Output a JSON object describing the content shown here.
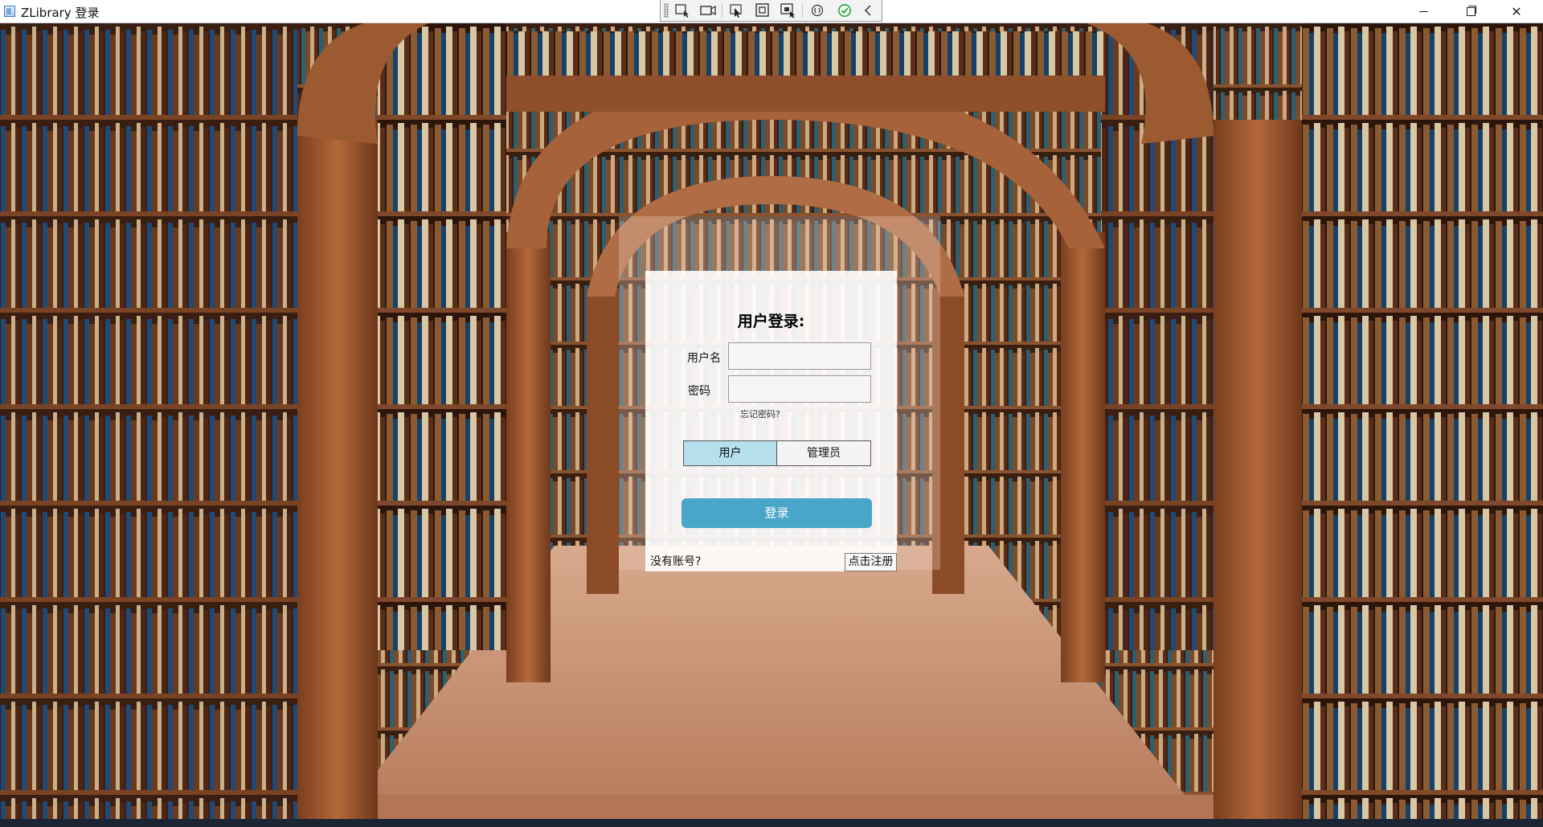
{
  "window": {
    "title": "ZLibrary 登录",
    "controls": {
      "minimize": "minimize-icon",
      "maximize": "restore-icon",
      "close": "✕"
    }
  },
  "toolbar": {
    "items": [
      "select-element-icon",
      "video-icon",
      "pointer-icon",
      "frame-icon",
      "screenshot-icon",
      "hot-reload-icon",
      "checkmark-icon",
      "collapse-icon"
    ]
  },
  "login": {
    "title": "用户登录:",
    "username_label": "用户名",
    "username_value": "",
    "password_label": "密码",
    "password_value": "",
    "forgot_password": "忘记密码?",
    "roles": [
      {
        "label": "用户",
        "selected": true
      },
      {
        "label": "管理员",
        "selected": false
      }
    ],
    "submit_label": "登录",
    "no_account_text": "没有账号?",
    "register_label": "点击注册"
  },
  "colors": {
    "accent": "#4aa6c9",
    "selected_role": "#b6dfee",
    "panel": "#ffffff"
  }
}
